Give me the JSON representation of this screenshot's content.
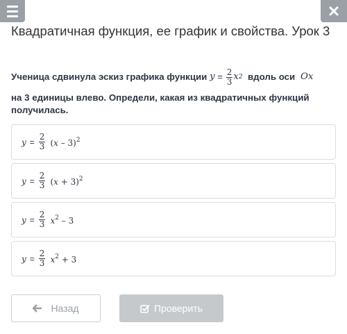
{
  "header": {
    "menu_icon": "hamburger-menu-icon",
    "close_icon": "close-icon",
    "title": "Квадратичная функция, ее график и свойства. Урок 3"
  },
  "question": {
    "text_before": "Ученица сдвинула эскиз графика функции ",
    "func_y": "y",
    "func_eq": " = ",
    "func_num": "2",
    "func_den": "3",
    "func_var": "x",
    "func_pow": "2",
    "text_mid": "  вдоль оси ",
    "axis": "Ox",
    "text_after": "на 3 единицы влево. Определи, какая из квадратичных функций получилась."
  },
  "options": [
    {
      "y": "y",
      "eq": "=",
      "num": "2",
      "den": "3",
      "expr_pre": "(",
      "var": "x",
      "expr_post": " – 3)",
      "pow": "2",
      "tail": ""
    },
    {
      "y": "y",
      "eq": "=",
      "num": "2",
      "den": "3",
      "expr_pre": "(",
      "var": "x",
      "expr_post": " + 3)",
      "pow": "2",
      "tail": ""
    },
    {
      "y": "y",
      "eq": "=",
      "num": "2",
      "den": "3",
      "expr_pre": "",
      "var": "x",
      "expr_post": "",
      "pow": "2",
      "tail": " – 3"
    },
    {
      "y": "y",
      "eq": "=",
      "num": "2",
      "den": "3",
      "expr_pre": "",
      "var": "x",
      "expr_post": "",
      "pow": "2",
      "tail": " + 3"
    }
  ],
  "footer": {
    "back_label": "Назад",
    "back_icon": "arrow-left-icon",
    "check_label": "Проверить",
    "check_icon": "checkbox-icon"
  },
  "colors": {
    "header_button_bg": "#9aa0a6",
    "check_button_bg": "#c6c9cc",
    "option_border": "#d9dce0"
  }
}
